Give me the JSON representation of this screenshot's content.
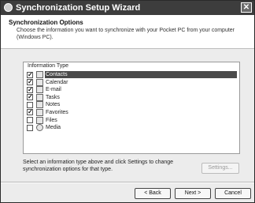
{
  "window": {
    "title": "Synchronization Setup Wizard",
    "close_glyph": "✕"
  },
  "header": {
    "title": "Synchronization Options",
    "description": "Choose the information you want to synchronize with your Pocket PC from your computer (Windows PC)."
  },
  "info_types": {
    "label": "Information Type",
    "items": [
      {
        "label": "Contacts",
        "checked": "✓",
        "icon": "contacts-icon",
        "selected": true
      },
      {
        "label": "Calendar",
        "checked": "✓",
        "icon": "calendar-icon"
      },
      {
        "label": "E-mail",
        "checked": "✓",
        "icon": "email-icon"
      },
      {
        "label": "Tasks",
        "checked": "✓",
        "icon": "tasks-icon"
      },
      {
        "label": "Notes",
        "checked": "",
        "icon": "notes-icon"
      },
      {
        "label": "Favorites",
        "checked": "✓",
        "icon": "favorites-icon"
      },
      {
        "label": "Files",
        "checked": "",
        "icon": "files-icon"
      },
      {
        "label": "Media",
        "checked": "",
        "icon": "media-icon"
      }
    ]
  },
  "instructions": "Select an information type above and click Settings to change synchronization options for that type.",
  "buttons": {
    "settings": "Settings...",
    "back": "< Back",
    "next": "Next >",
    "cancel": "Cancel"
  }
}
